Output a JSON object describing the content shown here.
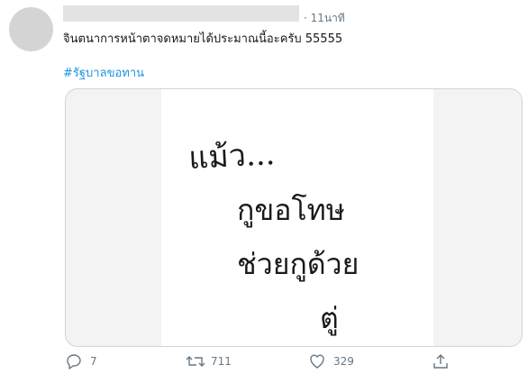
{
  "tweet": {
    "time": "· 11นาที",
    "text": "จินตนาการหน้าตาจดหมายได้ประมาณนี้อะครับ 55555",
    "hashtag": "#รัฐบาลขอทาน"
  },
  "media": {
    "handwriting": [
      "แม้ว...",
      "กูขอโทษ",
      "ช่วยกูด้วย",
      "ตู่"
    ]
  },
  "actions": {
    "reply_count": "7",
    "retweet_count": "711",
    "like_count": "329"
  },
  "colors": {
    "accent": "#1b95e0",
    "muted": "#657786",
    "border": "#ccd6dd"
  }
}
